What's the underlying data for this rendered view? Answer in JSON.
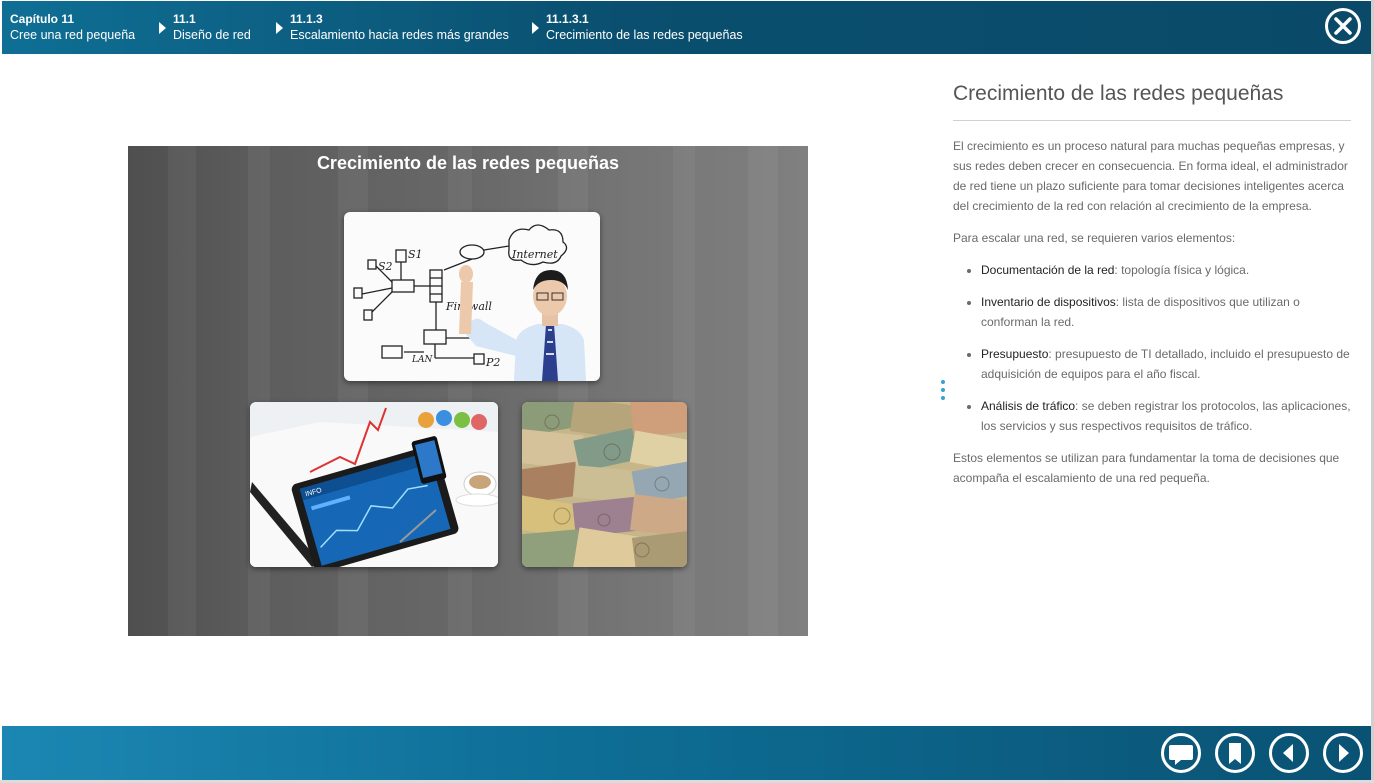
{
  "breadcrumbs": [
    {
      "number": "Capítulo 11",
      "label": "Cree una red pequeña"
    },
    {
      "number": "11.1",
      "label": "Diseño de red"
    },
    {
      "number": "11.1.3",
      "label": "Escalamiento hacia redes más grandes"
    },
    {
      "number": "11.1.3.1",
      "label": "Crecimiento de las redes pequeñas"
    }
  ],
  "slide": {
    "title": "Crecimiento de las redes pequeñas",
    "diagram_labels": {
      "s1": "S1",
      "s2": "S2",
      "firewall": "Firewall",
      "internet": "Internet",
      "lan": "LAN",
      "p1": "P1",
      "p2": "P2"
    },
    "tablet_brand": "INFO"
  },
  "content": {
    "title": "Crecimiento de las redes pequeñas",
    "intro": "El crecimiento es un proceso natural para muchas pequeñas empresas, y sus redes deben crecer en consecuencia. En forma ideal, el administrador de red tiene un plazo suficiente para tomar decisiones inteligentes acerca del crecimiento de la red con relación al crecimiento de la empresa.",
    "lead": "Para escalar una red, se requieren varios elementos:",
    "items": [
      {
        "term": "Documentación de la red",
        "desc": ": topología física y lógica."
      },
      {
        "term": "Inventario de dispositivos",
        "desc": ": lista de dispositivos que utilizan o conforman la red."
      },
      {
        "term": "Presupuesto",
        "desc": ": presupuesto de TI detallado, incluido el presupuesto de adquisición de equipos para el año fiscal."
      },
      {
        "term": "Análisis de tráfico",
        "desc": ": se deben registrar los protocolos, las aplicaciones, los servicios y sus respectivos requisitos de tráfico."
      }
    ],
    "closing": "Estos elementos se utilizan para fundamentar la toma de decisiones que acompaña el escalamiento de una red pequeña."
  },
  "icons": {
    "close": "close-icon",
    "comment": "comment-icon",
    "bookmark": "bookmark-icon",
    "previous": "previous-icon",
    "next": "next-icon",
    "more": "more-vertical-icon"
  },
  "colors": {
    "header": "#0a4f6f",
    "footer": "#0e6f97",
    "accent": "#3aa0d0"
  }
}
